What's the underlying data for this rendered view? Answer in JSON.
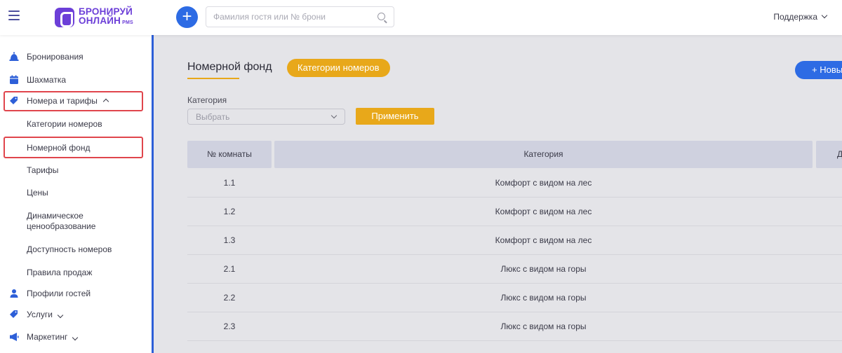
{
  "topbar": {
    "logo_line1": "БРОНИРУЙ",
    "logo_line2": "ОНЛАЙН",
    "logo_suffix": "PMS",
    "add_label": "+",
    "search_placeholder": "Фамилия гостя или № брони",
    "support_label": "Поддержка"
  },
  "sidebar": {
    "items": [
      {
        "label": "Бронирования",
        "icon": "bell-icon"
      },
      {
        "label": "Шахматка",
        "icon": "calendar-icon"
      },
      {
        "label": "Номера и тарифы",
        "icon": "tag-icon"
      },
      {
        "label": "Профили гостей",
        "icon": "user-icon"
      },
      {
        "label": "Услуги",
        "icon": "tag-icon"
      },
      {
        "label": "Маркетинг",
        "icon": "megaphone-icon"
      }
    ],
    "subitems": [
      {
        "label": "Категории номеров"
      },
      {
        "label": "Номерной фонд"
      },
      {
        "label": "Тарифы"
      },
      {
        "label": "Цены"
      },
      {
        "label": "Динамическое ценообразование"
      },
      {
        "label": "Доступность номеров"
      },
      {
        "label": "Правила продаж"
      }
    ]
  },
  "main": {
    "title": "Номерной фонд",
    "categories_tab": "Категории номеров",
    "new_button": "+ Новы",
    "filter_label": "Категория",
    "select_value": "Выбрать",
    "apply_button": "Применить",
    "table": {
      "headers": [
        "№ комнаты",
        "Категория",
        "Д"
      ],
      "rows": [
        [
          "1.1",
          "Комфорт с видом на лес"
        ],
        [
          "1.2",
          "Комфорт с видом на лес"
        ],
        [
          "1.3",
          "Комфорт с видом на лес"
        ],
        [
          "2.1",
          "Люкс с видом на горы"
        ],
        [
          "2.2",
          "Люкс с видом на горы"
        ],
        [
          "2.3",
          "Люкс с видом на горы"
        ]
      ]
    }
  },
  "colors": {
    "accent_blue": "#2d6be4",
    "accent_yellow": "#e8a81a",
    "brand_purple": "#6c3fd8",
    "highlight_red": "#e0454c"
  }
}
